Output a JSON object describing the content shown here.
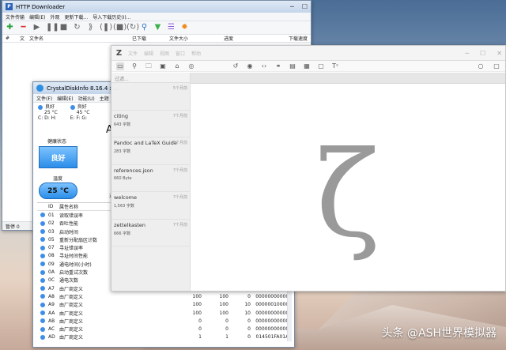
{
  "httpdl": {
    "title": "HTTP Downloader",
    "menu": [
      "文件传输",
      "编辑(E)",
      "外观",
      "更新下载...",
      "导入下载历史(I)..."
    ],
    "columns": [
      "#",
      "文",
      "文件名",
      "已下载",
      "文件大小",
      "进度",
      "下载速度"
    ],
    "status": "暂停 0"
  },
  "cdi": {
    "title": "CrystalDiskInfo 8.16.4 x64",
    "menu": [
      "文件(F)",
      "编辑(E)",
      "功能(U)",
      "主题"
    ],
    "drives": [
      {
        "status": "良好",
        "temp": "25 °C",
        "letters": "C: D: H:"
      },
      {
        "status": "良好",
        "temp": "45 °C",
        "letters": "E: F: G:"
      }
    ],
    "model_fragment": "A",
    "health_label": "健康状态",
    "health_value": "良好",
    "temp_label": "温度",
    "temp_value": "25 °C",
    "side_mark": "对",
    "smart_header": {
      "id": "ID",
      "name": "属性名称"
    },
    "smart": [
      {
        "id": "01",
        "name": "读取错误率"
      },
      {
        "id": "02",
        "name": "吞吐性能"
      },
      {
        "id": "03",
        "name": "启动时间"
      },
      {
        "id": "05",
        "name": "重新分配扇区计数"
      },
      {
        "id": "07",
        "name": "寻址错误率"
      },
      {
        "id": "08",
        "name": "寻址时间性能"
      },
      {
        "id": "09",
        "name": "通电时间(小时)"
      },
      {
        "id": "0A",
        "name": "启动重试次数"
      },
      {
        "id": "0C",
        "name": "通电次数"
      },
      {
        "id": "A7",
        "name": "由厂商定义"
      },
      {
        "id": "A8",
        "name": "由厂商定义",
        "cur": "100",
        "wor": "100",
        "thr": "0",
        "raw": "000000000000"
      },
      {
        "id": "A9",
        "name": "由厂商定义",
        "cur": "100",
        "wor": "100",
        "thr": "10",
        "raw": "000000100002"
      },
      {
        "id": "AA",
        "name": "由厂商定义",
        "cur": "100",
        "wor": "100",
        "thr": "10",
        "raw": "000000000000"
      },
      {
        "id": "AB",
        "name": "由厂商定义",
        "cur": "0",
        "wor": "0",
        "thr": "0",
        "raw": "000000000000"
      },
      {
        "id": "AC",
        "name": "由厂商定义",
        "cur": "0",
        "wor": "0",
        "thr": "0",
        "raw": "000000000000"
      },
      {
        "id": "AD",
        "name": "由厂商定义",
        "cur": "1",
        "wor": "1",
        "thr": "0",
        "raw": "014501FA01A2"
      }
    ]
  },
  "zettlr": {
    "menu": [
      "文件",
      "编辑",
      "视图",
      "窗口",
      "帮助"
    ],
    "filter_placeholder": "过滤...",
    "files": [
      {
        "title": "…",
        "meta": "",
        "date": "5个月前",
        "faded": true
      },
      {
        "title": "citing",
        "meta": "643 字数",
        "date": "7个月前"
      },
      {
        "title": "Pandoc and LaTeX Guide",
        "meta": "283 字数",
        "date": "7个月前"
      },
      {
        "title": "references.json",
        "meta": "660 Byte",
        "date": "7个月前"
      },
      {
        "title": "welcome",
        "meta": "1,563 字数",
        "date": "7个月前"
      },
      {
        "title": "zettelkasten",
        "meta": "666 字数",
        "date": "7个月前"
      }
    ],
    "big_glyph": "ζ"
  },
  "watermark": "头条 @ASH世界模拟器",
  "colors": {
    "accent_blue": "#3e8de8",
    "zettlr_gray": "#9a9a9a"
  }
}
